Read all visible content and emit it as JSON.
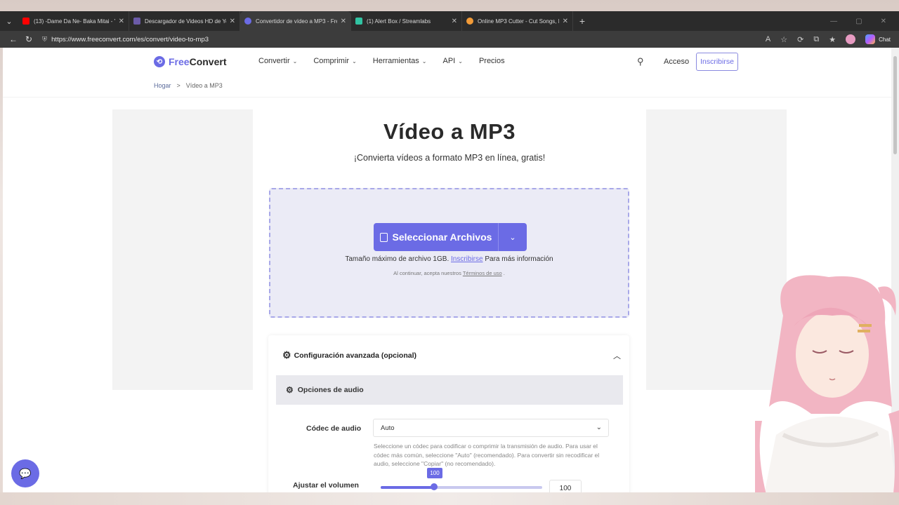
{
  "browser": {
    "tabs": [
      {
        "title": "(13) -Dame Da Ne- Baka Mitai - Yo",
        "favicon_color": "#ff0000",
        "active": false
      },
      {
        "title": "Descargador de Videos HD de Yo",
        "favicon_color": "#6b5ba8",
        "active": false
      },
      {
        "title": "Convertidor de vídeo a MP3 - Free",
        "favicon_color": "#6b6be5",
        "active": true
      },
      {
        "title": "(1) Alert Box / Streamlabs",
        "favicon_color": "#31c3a2",
        "active": false
      },
      {
        "title": "Online MP3 Cutter - Cut Songs, M",
        "favicon_color": "#f29b38",
        "active": false
      }
    ],
    "tab_close": "✕",
    "new_tab": "+",
    "url": "https://www.freeconvert.com/es/convert/video-to-mp3",
    "chat_label": "Chat"
  },
  "site": {
    "logo_free": "Free",
    "logo_convert": "Convert",
    "nav": [
      {
        "label": "Convertir",
        "has_dropdown": true
      },
      {
        "label": "Comprimir",
        "has_dropdown": true
      },
      {
        "label": "Herramientas",
        "has_dropdown": true
      },
      {
        "label": "API",
        "has_dropdown": true
      },
      {
        "label": "Precios",
        "has_dropdown": false
      }
    ],
    "login": "Acceso",
    "signup": "Inscribirse",
    "breadcrumb": {
      "home": "Hogar",
      "current": "Vídeo a MP3",
      "separator": ">"
    }
  },
  "main": {
    "title": "Vídeo a MP3",
    "subtitle": "¡Convierta vídeos a formato MP3 en línea, gratis!",
    "select_button": "Seleccionar Archivos",
    "max_size_text": "Tamaño máximo de archivo 1GB.",
    "max_size_link": "Inscribirse",
    "max_size_suffix": "Para más información",
    "terms_prefix": "Al continuar, acepta nuestros",
    "terms_link": "Términos de uso",
    "terms_suffix": "."
  },
  "advanced": {
    "title": "Configuración avanzada (opcional)",
    "audio_section": "Opciones de audio",
    "codec_label": "Códec de audio",
    "codec_value": "Auto",
    "codec_help": "Seleccione un códec para codificar o comprimir la transmisión de audio. Para usar el códec más común, seleccione \"Auto\" (recomendado). Para convertir sin recodificar el audio, seleccione \"Copiar\" (no recomendado).",
    "volume_label": "Ajustar el volumen",
    "volume_tooltip": "100",
    "volume_value": "100",
    "volume_fraction": 0.33
  },
  "colors": {
    "accent": "#6b6be5",
    "browser_chrome": "#3c3c3c"
  }
}
